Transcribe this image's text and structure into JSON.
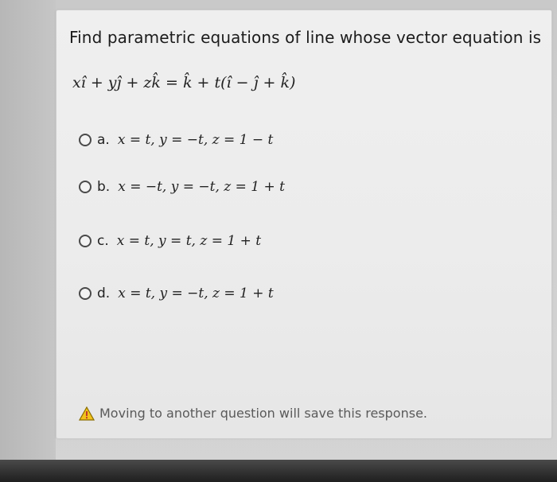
{
  "question": {
    "title": "Find parametric equations of line whose vector equation is",
    "equation": "xî + yĵ + zk̂ = k̂ + t(î − ĵ + k̂)"
  },
  "options": [
    {
      "letter": "a.",
      "text": "x = t, y = −t, z = 1 − t"
    },
    {
      "letter": "b.",
      "text": "x = −t, y = −t, z = 1 + t"
    },
    {
      "letter": "c.",
      "text": "x = t, y = t, z = 1 + t"
    },
    {
      "letter": "d.",
      "text": "x = t, y = −t, z = 1 + t"
    }
  ],
  "warning": {
    "icon": "warning-triangle-icon",
    "text": "Moving to another question will save this response."
  }
}
